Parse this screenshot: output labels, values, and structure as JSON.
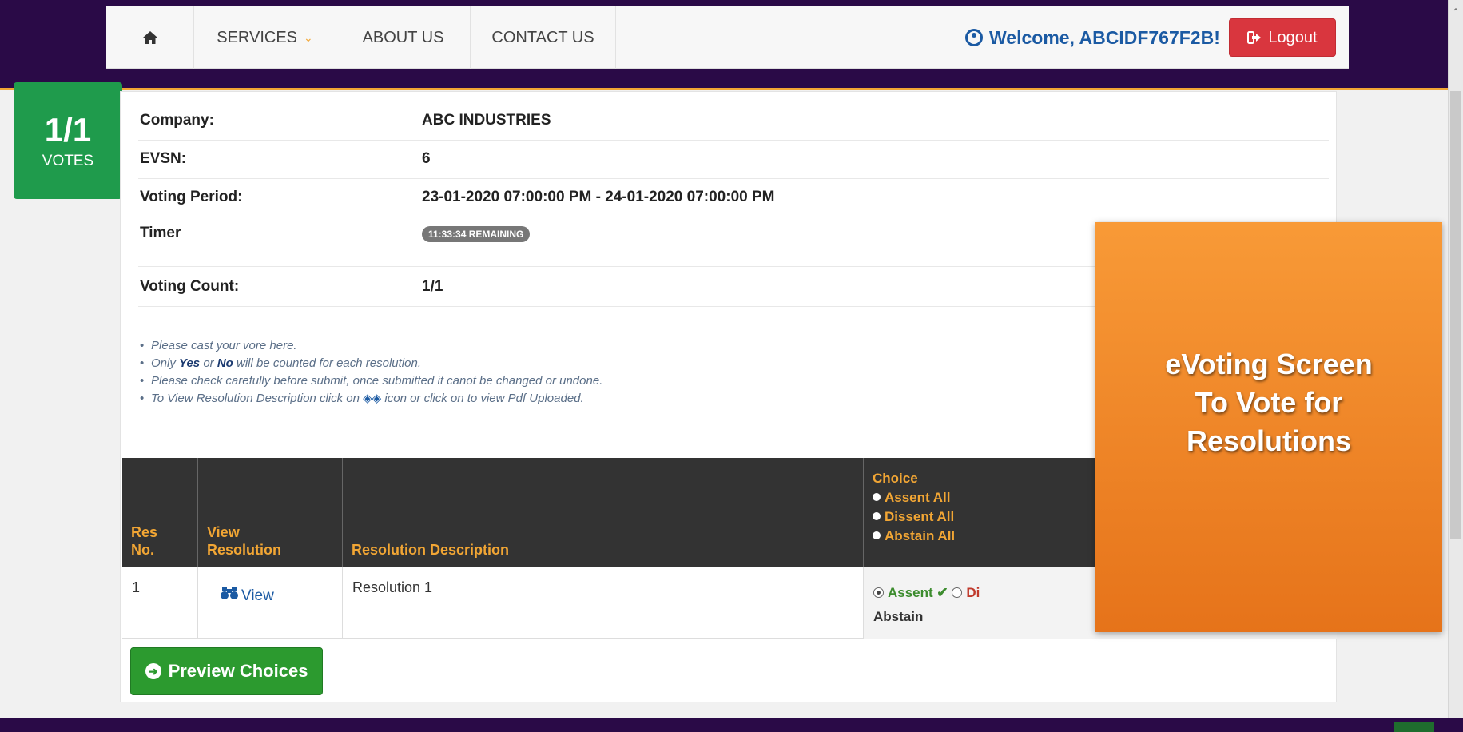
{
  "nav": {
    "home_icon": "home-icon",
    "services": "SERVICES",
    "about": "ABOUT US",
    "contact": "CONTACT US",
    "welcome": "Welcome, ABCIDF767F2B!",
    "logout": "Logout"
  },
  "votes_badge": {
    "count": "1/1",
    "label": "VOTES"
  },
  "info": {
    "company_label": "Company:",
    "company_value": "ABC INDUSTRIES",
    "evsn_label": "EVSN:",
    "evsn_value": "6",
    "period_label": "Voting Period:",
    "period_value": "23-01-2020 07:00:00 PM - 24-01-2020 07:00:00 PM",
    "timer_label": "Timer",
    "timer_value": "11:33:34 REMAINING",
    "count_label": "Voting Count:",
    "count_value": "1/1"
  },
  "notes": {
    "line1": "Please cast your vore here.",
    "line2_pre": "Only ",
    "line2_yes": "Yes",
    "line2_mid": " or ",
    "line2_no": "No",
    "line2_post": " will be counted for each resolution.",
    "line3": "Please check carefully before submit, once submitted it canot be changed or undone.",
    "line4_pre": "To View Resolution Description click on ",
    "line4_post": "icon or click on  to view Pdf Uploaded."
  },
  "table": {
    "headers": {
      "res_no_1": "Res",
      "res_no_2": "No.",
      "view_1": "View",
      "view_2": "Resolution",
      "description": "Resolution Description",
      "choice": "Choice",
      "assent_all": "Assent All",
      "dissent_all": "Dissent All",
      "abstain_all": "Abstain All"
    },
    "rows": [
      {
        "res_no": "1",
        "view": "View",
        "description": "Resolution 1",
        "assent": "Assent",
        "check": "✔",
        "dissent": "Di",
        "abstain": "Abstain",
        "selected": "Assent"
      }
    ]
  },
  "preview_button": "Preview Choices",
  "overlay": {
    "line1": "eVoting Screen",
    "line2": "To Vote for",
    "line3": "Resolutions"
  }
}
